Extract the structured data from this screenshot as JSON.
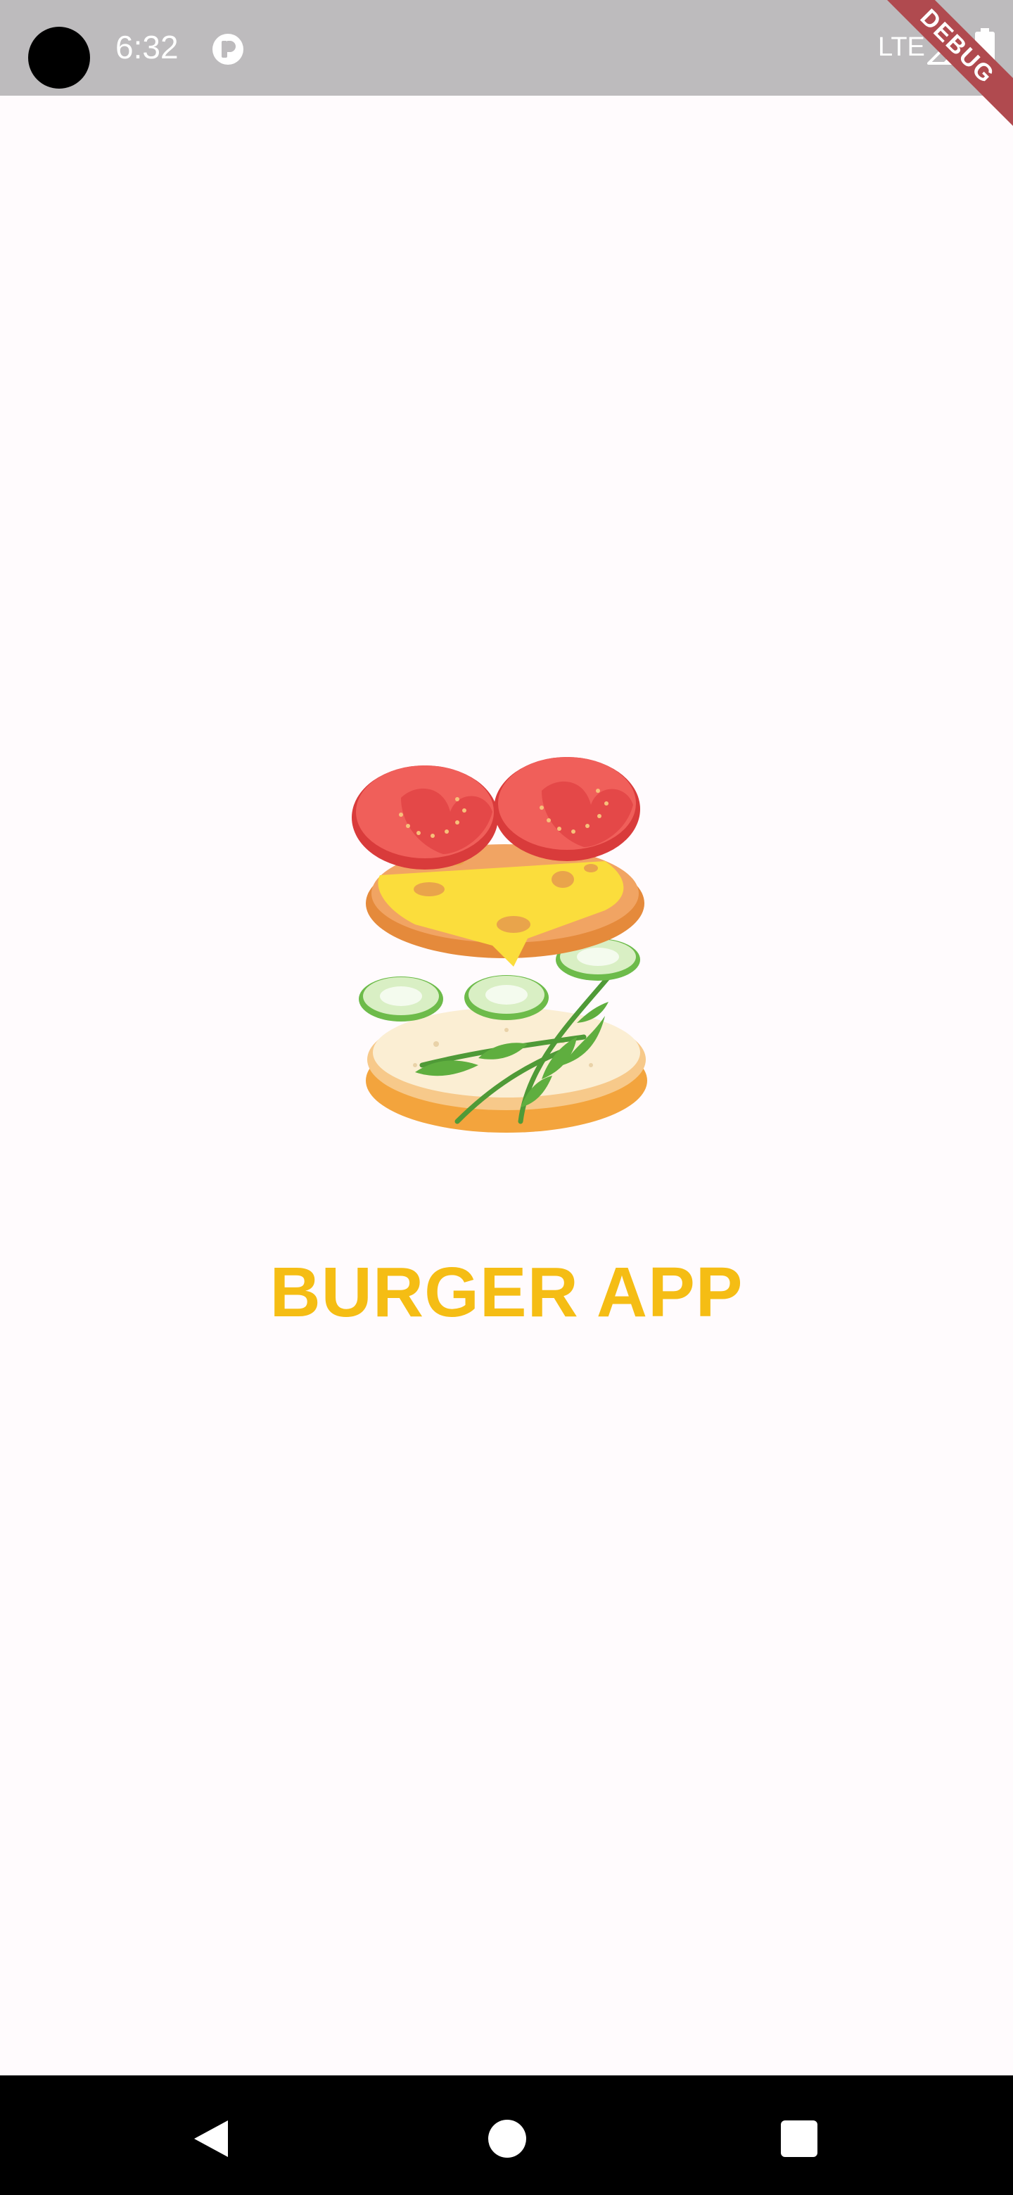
{
  "status_bar": {
    "time": "6:32",
    "network": "LTE",
    "icons": {
      "camera": "camera-cutout",
      "app_notification": "app-notification-icon",
      "signal": "signal-icon",
      "battery": "battery-icon"
    }
  },
  "debug_banner": {
    "label": "DEBUG"
  },
  "splash": {
    "illustration": "burger-illustration",
    "title": "BURGER APP",
    "title_color": "#f5bd14"
  },
  "nav_bar": {
    "buttons": [
      "back-icon",
      "home-icon",
      "recents-icon"
    ]
  }
}
